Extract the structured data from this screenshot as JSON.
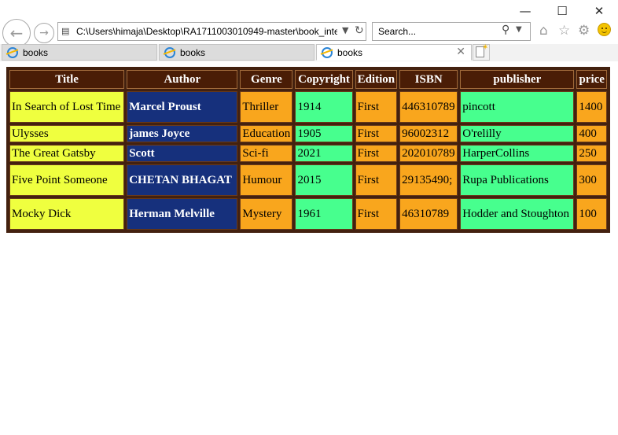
{
  "browser": {
    "address": "C:\\Users\\himaja\\Desktop\\RA1711003010949-master\\book_inte",
    "search_placeholder": "Search...",
    "tabs": [
      {
        "label": "books",
        "active": false
      },
      {
        "label": "books",
        "active": false
      },
      {
        "label": "books",
        "active": true
      }
    ]
  },
  "table": {
    "headers": [
      "Title",
      "Author",
      "Genre",
      "Copyright",
      "Edition",
      "ISBN",
      "publisher",
      "price"
    ],
    "rows": [
      [
        "In Search of Lost Time",
        "Marcel Proust",
        "Thriller",
        "1914",
        "First",
        "446310789",
        "pincott",
        "1400"
      ],
      [
        "Ulysses",
        "james Joyce",
        "Education",
        "1905",
        "First",
        "96002312",
        "O'relilly",
        "400"
      ],
      [
        "The Great Gatsby",
        "Scott",
        "Sci-fi",
        "2021",
        "First",
        "202010789",
        "HarperCollins",
        "250"
      ],
      [
        "Five Point Someone",
        "CHETAN BHAGAT",
        "Humour",
        "2015",
        "First",
        "29135490;",
        "Rupa Publications",
        "300"
      ],
      [
        "Mocky Dick",
        "Herman Melville",
        "Mystery",
        "1961",
        "First",
        "46310789",
        "Hodder and Stoughton",
        "100"
      ]
    ]
  },
  "colors": {
    "header_bg": "#4a1d06",
    "title_bg": "#efff3f",
    "author_bg": "#16307c",
    "orange_bg": "#f9a61d",
    "green_bg": "#47ff8e"
  }
}
